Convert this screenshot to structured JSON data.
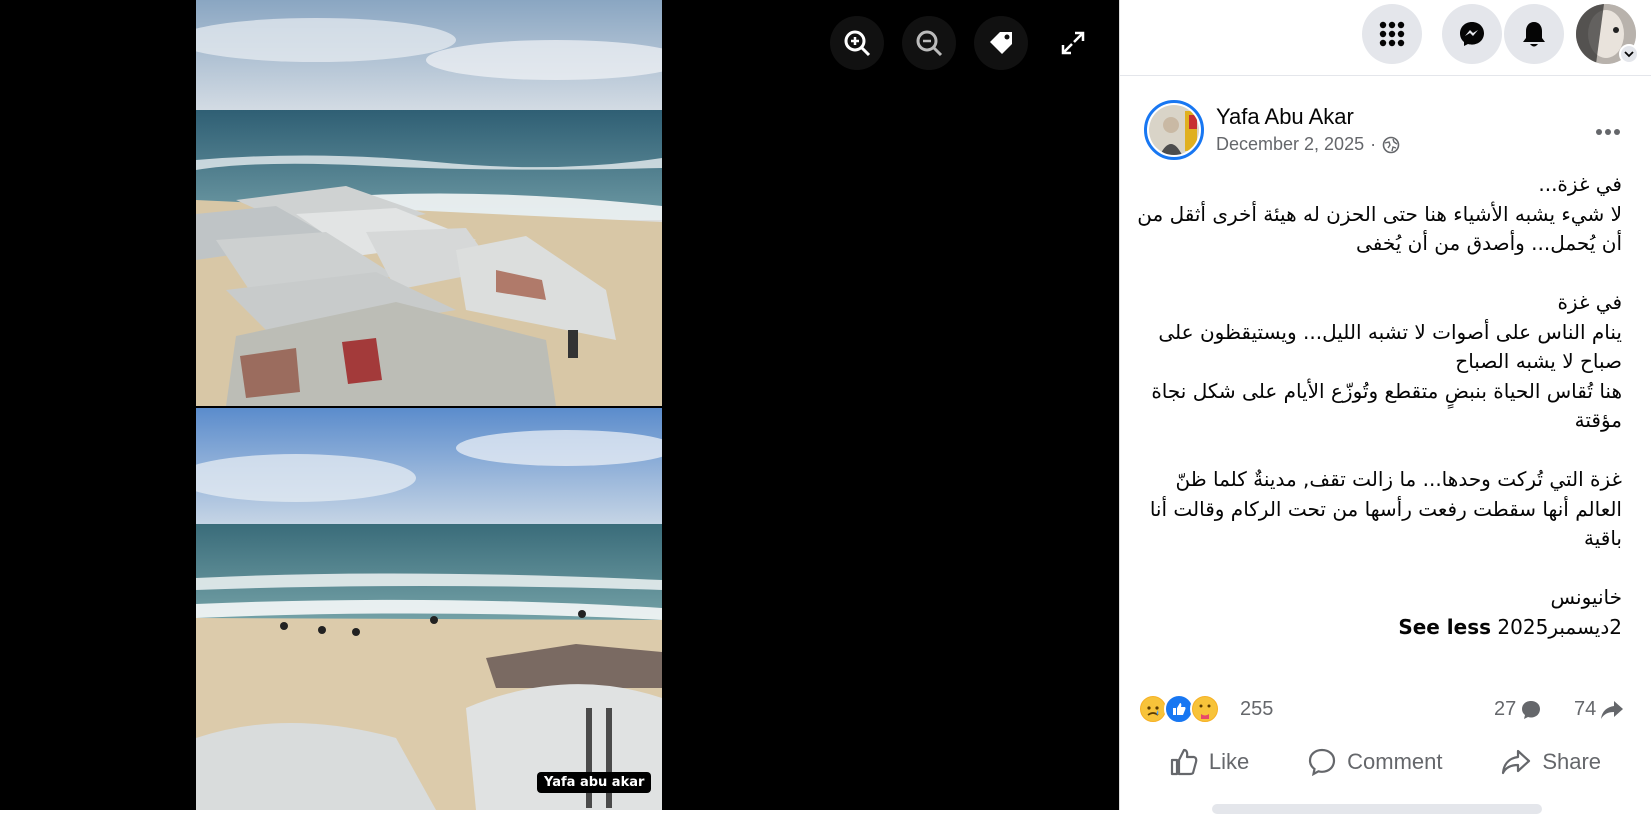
{
  "viewer": {
    "watermark": "Yafa abu akar",
    "tools": [
      "zoom-in-icon",
      "zoom-out-icon",
      "tag-icon",
      "fullscreen-icon"
    ]
  },
  "topbar": {
    "icons": [
      "menu-grid-icon",
      "messenger-icon",
      "notifications-bell-icon",
      "account-caret-icon"
    ]
  },
  "post": {
    "author": "Yafa Abu Akar",
    "date": "December 2, 2025",
    "date_separator": "·",
    "privacy_icon": "globe-icon",
    "paragraphs": [
      "في غزة...\nلا شيء يشبه الأشياء هنا حتى الحزن له هيئة أخرى أثقل من أن يُحمل... وأصدق من أن يُخفى",
      "في غزة\nينام الناس على أصوات لا تشبه الليل... ويستيقظون على صباح لا يشبه الصباح\nهنا تُقاس الحياة بنبضٍ متقطع وتُوزّع الأيام على شكل نجاة مؤقتة",
      "غزة التي تُركت وحدها... ما زالت تقف, مدينةٌ كلما ظنّ العالم أنها سقطت رفعت رأسها من تحت الركام وقالت أنا باقية",
      "خانيونس"
    ],
    "last_line": "2ديسمبر2025",
    "see_less": "See less",
    "reaction_icons": [
      "sad-reaction-icon",
      "like-reaction-icon",
      "care-reaction-icon"
    ],
    "reaction_count": "255",
    "comment_count": "27",
    "share_count": "74",
    "actions": {
      "like": "Like",
      "comment": "Comment",
      "share": "Share"
    }
  },
  "colors": {
    "viewer_bg": "#000000",
    "accent": "#1877f2",
    "secondary_text": "#65676b",
    "button_bg": "#e4e6eb"
  }
}
